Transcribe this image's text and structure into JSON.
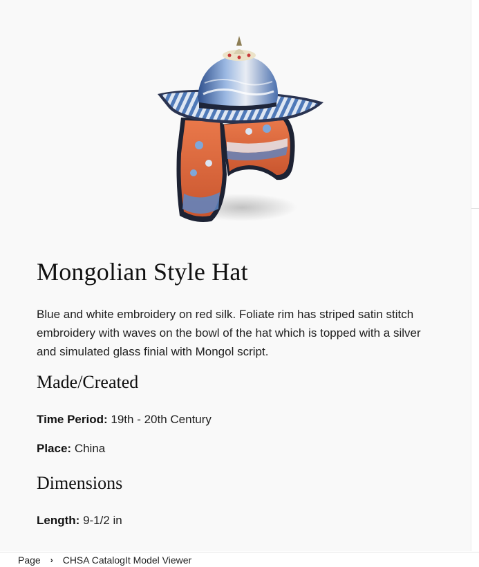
{
  "object": {
    "image_alt": "Mongolian style hat with embroidered ear flaps",
    "title": "Mongolian Style Hat",
    "description": "Blue and white embroidery on red silk. Foliate rim has striped satin stitch embroidery with waves on the bowl of the hat which is topped with a silver and simulated glass finial with Mongol script."
  },
  "made_created": {
    "heading": "Made/Created",
    "time_period_label": "Time Period:",
    "time_period_value": "19th - 20th Century",
    "place_label": "Place:",
    "place_value": "China"
  },
  "dimensions": {
    "heading": "Dimensions",
    "length_label": "Length:",
    "length_value": "9-1/2 in"
  },
  "breadcrumb": {
    "root": "Page",
    "separator_icon": "chevron-right-icon",
    "current": "CHSA CatalogIt Model Viewer"
  },
  "colors": {
    "background": "#f9f9f9",
    "hat_blue": "#5d86c4",
    "hat_red": "#d66a3f"
  }
}
